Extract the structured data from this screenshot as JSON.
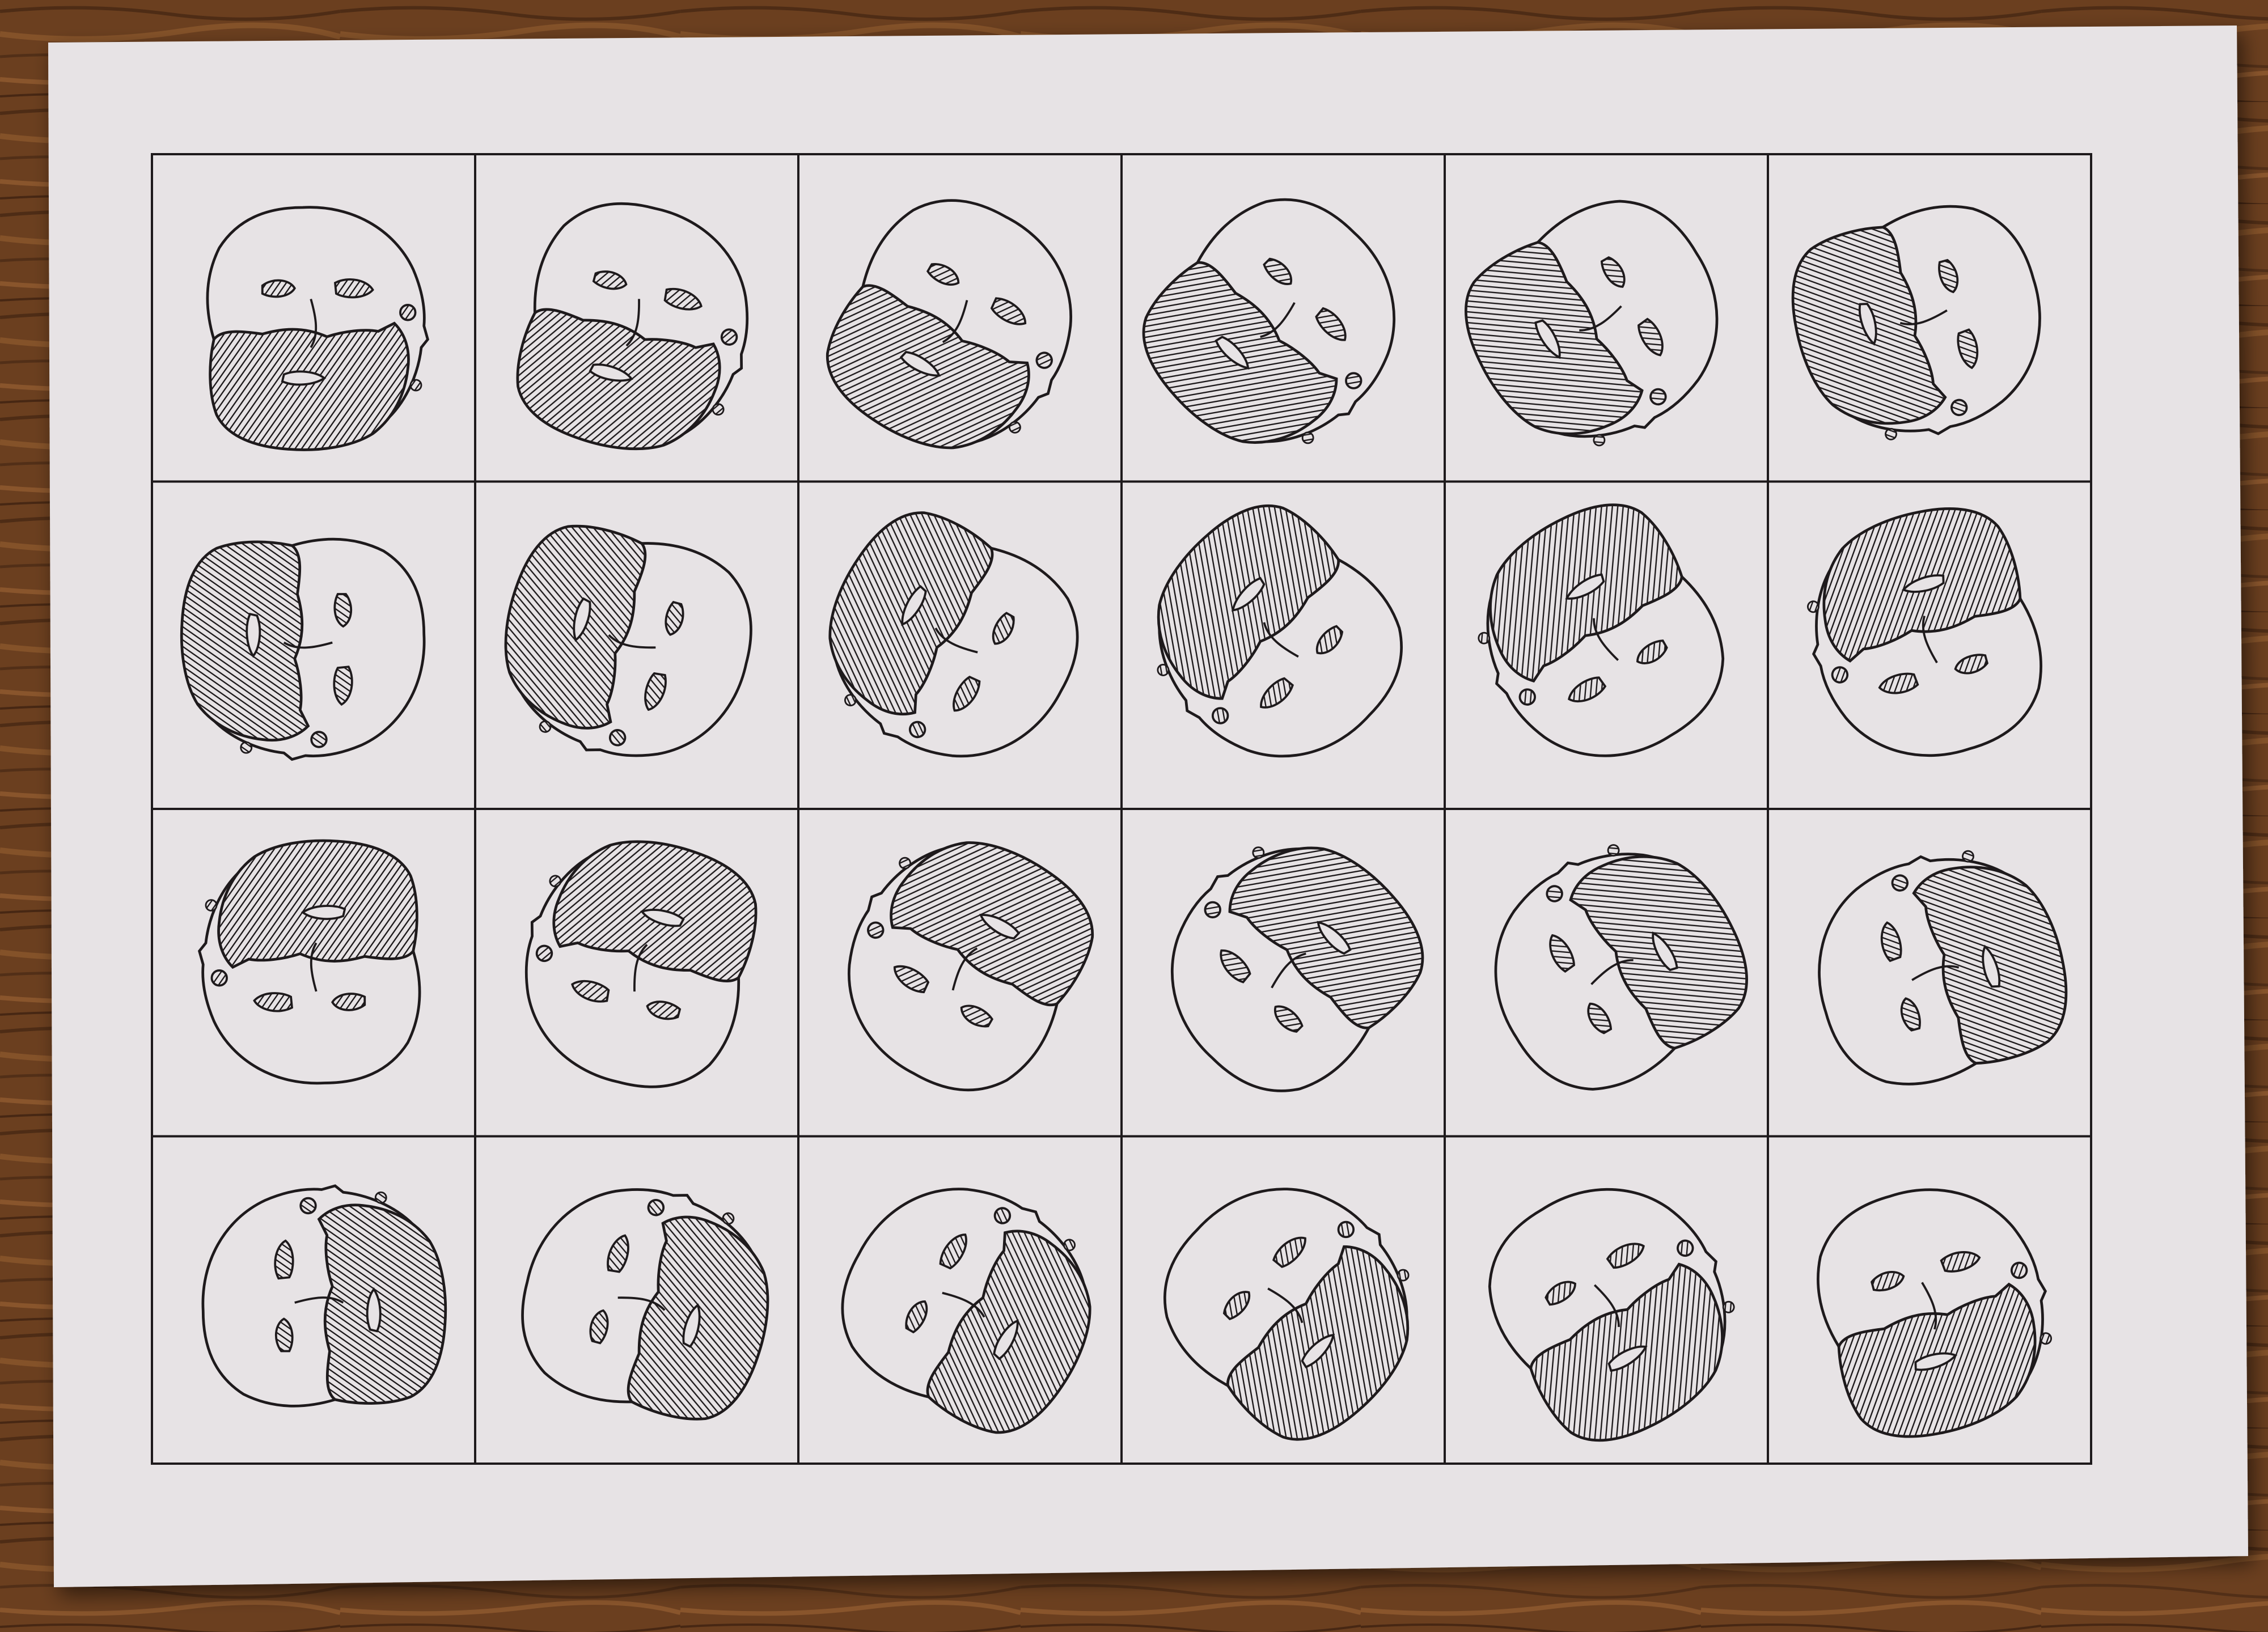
{
  "scene": {
    "colors": {
      "wood_dark": "#3a200f",
      "wood_mid": "#6b3f1f",
      "wood_light": "#8f5a2e",
      "paper": "#e7e3e5",
      "paper_shadow": "#c9c4c6",
      "ink": "#1e1a1c"
    },
    "grid": {
      "rows": 4,
      "cols": 6
    },
    "cells": [
      {
        "angle": 0
      },
      {
        "angle": 15
      },
      {
        "angle": 30
      },
      {
        "angle": 45
      },
      {
        "angle": 60
      },
      {
        "angle": 75
      },
      {
        "angle": 90
      },
      {
        "angle": 105
      },
      {
        "angle": 120
      },
      {
        "angle": 135
      },
      {
        "angle": 150
      },
      {
        "angle": 165
      },
      {
        "angle": 180
      },
      {
        "angle": 195
      },
      {
        "angle": 210
      },
      {
        "angle": 225
      },
      {
        "angle": 240
      },
      {
        "angle": 255
      },
      {
        "angle": 270
      },
      {
        "angle": 285
      },
      {
        "angle": 300
      },
      {
        "angle": 315
      },
      {
        "angle": 330
      },
      {
        "angle": 345
      }
    ]
  }
}
